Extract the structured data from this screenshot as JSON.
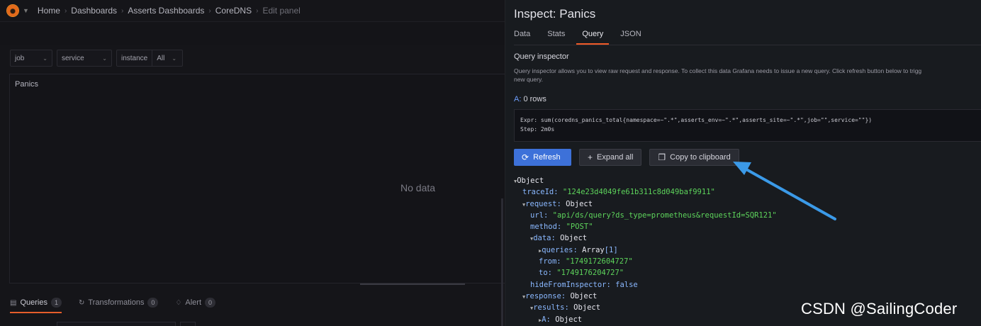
{
  "breadcrumb": [
    "Home",
    "Dashboards",
    "Asserts Dashboards",
    "CoreDNS",
    "Edit panel"
  ],
  "variables": [
    {
      "label": "job",
      "value": ""
    },
    {
      "label": "service",
      "value": ""
    },
    {
      "label": "instance",
      "value": "All"
    }
  ],
  "panel": {
    "title": "Panics",
    "empty_text": "No data"
  },
  "editor_tabs": [
    {
      "label": "Queries",
      "count": "1"
    },
    {
      "label": "Transformations",
      "count": "0"
    },
    {
      "label": "Alert",
      "count": "0"
    }
  ],
  "inspect": {
    "title": "Inspect: Panics",
    "tabs": [
      "Data",
      "Stats",
      "Query",
      "JSON"
    ],
    "active_tab": "Query",
    "query_inspector_title": "Query inspector",
    "description": "Query inspector allows you to view raw request and response. To collect this data Grafana needs to issue a new query. Click refresh button below to trigg",
    "description_cont": "new query.",
    "query_ref": "A:",
    "rows_text": "0 rows",
    "expr": "Expr: sum(coredns_panics_total{namespace=~\".*\",asserts_env=~\".*\",asserts_site=~\".*\",job=\"\",service=\"\"})",
    "step": "Step: 2m0s",
    "buttons": {
      "refresh": "Refresh",
      "expand": "Expand all",
      "copy": "Copy to clipboard"
    }
  },
  "tree": {
    "root": "Object",
    "traceId_key": "traceId:",
    "traceId_val": "\"124e23d4049fe61b311c8d049baf9911\"",
    "request_key": "request:",
    "request_type": "Object",
    "url_key": "url:",
    "url_val": "\"api/ds/query?ds_type=prometheus&requestId=SQR121\"",
    "method_key": "method:",
    "method_val": "\"POST\"",
    "data_key": "data:",
    "data_type": "Object",
    "queries_key": "queries:",
    "queries_type": "Array",
    "queries_len": "[1]",
    "from_key": "from:",
    "from_val": "\"1749172604727\"",
    "to_key": "to:",
    "to_val": "\"1749176204727\"",
    "hide_key": "hideFromInspector:",
    "hide_val": "false",
    "response_key": "response:",
    "response_type": "Object",
    "results_key": "results:",
    "results_type": "Object",
    "a_key": "A:",
    "a_type": "Object"
  },
  "watermark": "CSDN @SailingCoder",
  "colors": {
    "accent": "#f05a28",
    "primary_button": "#3d71d9",
    "string": "#5dd35b",
    "key": "#8ab8ff",
    "annotation_arrow": "#3b9ae8"
  }
}
